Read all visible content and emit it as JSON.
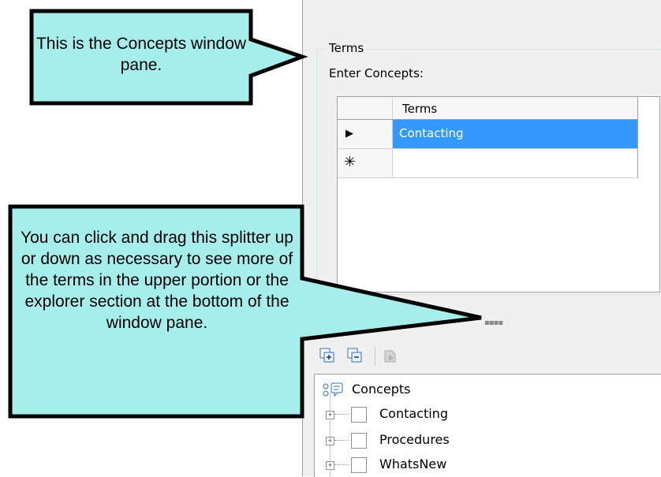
{
  "group": {
    "title": "Terms",
    "prompt": "Enter Concepts:"
  },
  "grid": {
    "header": "Terms",
    "rows": [
      {
        "indicator": "▶",
        "value": "Contacting",
        "selected": true
      },
      {
        "indicator": "✳",
        "value": ""
      }
    ]
  },
  "splitter": {
    "grip": "▪▪▪▪"
  },
  "toolbar": {
    "buttons": [
      "expand-all-icon",
      "collapse-all-icon",
      "paste-icon"
    ]
  },
  "tree": {
    "root": "Concepts",
    "items": [
      {
        "label": "Contacting",
        "expander": "+"
      },
      {
        "label": "Procedures",
        "expander": "+"
      },
      {
        "label": "WhatsNew",
        "expander": "+"
      }
    ]
  },
  "callouts": {
    "top": "This is the Concepts window pane.",
    "bottom": "You can click and drag this splitter up or down as necessary to see more of the terms in the upper portion or the explorer section at the bottom of the window pane."
  },
  "colors": {
    "callout_fill": "#a5eeec",
    "selection": "#3399ff"
  }
}
